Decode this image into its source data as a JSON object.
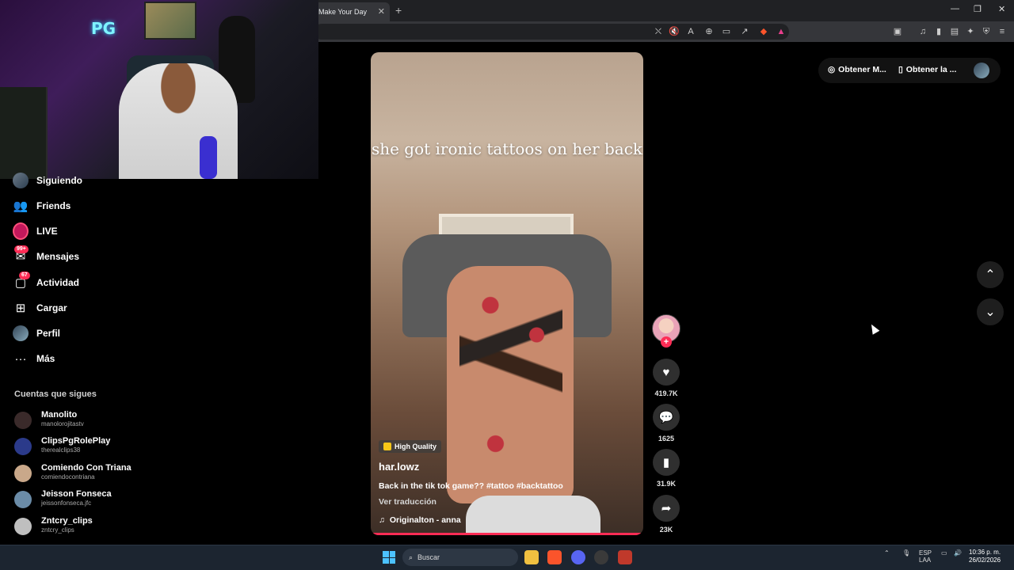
{
  "browser": {
    "tab_title": "Make Your Day",
    "tab_close": "✕",
    "new_tab": "+",
    "minimize": "—",
    "maximize": "❐",
    "close": "✕"
  },
  "webcam": {
    "neon_sign": "PG"
  },
  "nav": {
    "items": [
      {
        "label": "Siguiendo",
        "icon": "following-avatar-icon"
      },
      {
        "label": "Friends",
        "icon": "friends-icon"
      },
      {
        "label": "LIVE",
        "icon": "live-icon"
      },
      {
        "label": "Mensajes",
        "icon": "messages-icon",
        "badge": "99+"
      },
      {
        "label": "Actividad",
        "icon": "activity-icon",
        "badge": "67"
      },
      {
        "label": "Cargar",
        "icon": "upload-icon"
      },
      {
        "label": "Perfil",
        "icon": "profile-avatar-icon"
      },
      {
        "label": "Más",
        "icon": "more-icon"
      }
    ]
  },
  "following": {
    "title": "Cuentas que sigues",
    "accounts": [
      {
        "name": "Manolito",
        "handle": "manolorojitastv",
        "color": "#3a2a2a"
      },
      {
        "name": "ClipsPgRolePlay",
        "handle": "therealclips38",
        "color": "#2b3a8a"
      },
      {
        "name": "Comiendo Con Triana",
        "handle": "comiendocontriana",
        "color": "#c9a88a"
      },
      {
        "name": "Jeisson Fonseca",
        "handle": "jeissonfonseca.jfc",
        "color": "#6b8ca8"
      },
      {
        "name": "Zntcry_clips",
        "handle": "zntcry_clips",
        "color": "#bfbfbf"
      }
    ]
  },
  "video": {
    "overlay_text": "she got ironic tattoos on her back",
    "quality_badge": "High Quality",
    "author": "har.lowz",
    "description": "Back in the tik tok game?? #tattoo #backtattoo",
    "translate": "Ver traducción",
    "music": "Originalton - anna",
    "progress": 1.0
  },
  "actions": {
    "likes": "419.7K",
    "comments": "1625",
    "saves": "31.9K",
    "shares": "23K"
  },
  "top_right": {
    "get_app_1": "Obtener M...",
    "get_app_2": "Obtener la ..."
  },
  "taskbar": {
    "search_placeholder": "Buscar",
    "lang_1": "ESP",
    "lang_2": "LAA",
    "time": "10:36 p. m.",
    "date": "26/02/2026"
  },
  "colors": {
    "accent": "#fe2c55",
    "background": "#000000"
  }
}
